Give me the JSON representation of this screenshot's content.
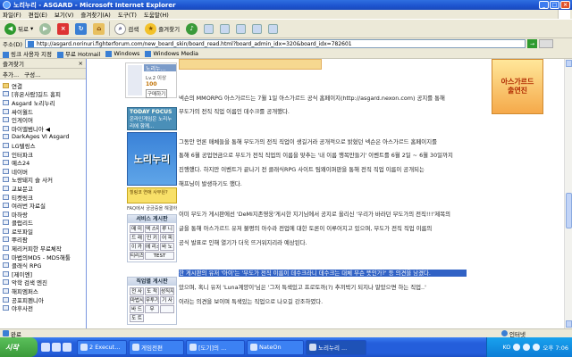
{
  "window": {
    "title": "노리누리 - ASGARD - Microsoft Internet Explorer",
    "min": "_",
    "max": "□",
    "close": "×"
  },
  "menu": [
    "파일(F)",
    "편집(E)",
    "보기(V)",
    "즐겨찾기(A)",
    "도구(T)",
    "도움말(H)"
  ],
  "toolbar": {
    "back": "뒤로",
    "search": "검색",
    "favorites": "즐겨찾기"
  },
  "address": {
    "label": "주소(D)",
    "url": "http://asgard.norinuri.fighterforum.com/new_board_skin/board_read.html?board_admin_idx=320&board_idx=782601",
    "go": "이동"
  },
  "links": {
    "label": "연결",
    "items": [
      "링크 사용자 지정",
      "무료 Hotmail",
      "Windows",
      "Windows Media"
    ]
  },
  "sidebar": {
    "title": "즐겨찾기",
    "add": "추가...",
    "organize": "구성...",
    "items": [
      "연결",
      "[휴온사람]길드 홈피",
      "Asgard 노리누리",
      "싸이월드",
      "인게이머",
      "마이앨범니아 ◀",
      "DarkAges VI  Asgard",
      "LG텔링스",
      "인터파크",
      "예스24",
      "네이버",
      "노랑돼지 슬 사커",
      "교보문고",
      "티켓링크",
      "여러번 자료실",
      "마하랑",
      "클럽리드",
      "로또파일",
      "뿌리팜",
      "제리커피한 무료체작",
      "마법의MD5 - MD5해툴",
      "클래식 RPG",
      "[제이엔]",
      "악학 검색 엔진",
      "해피엠퍼스",
      "공포피펜니아",
      "야후사전"
    ]
  },
  "left_nav": {
    "nickname": "노리누...",
    "level": "Lv.2 이상",
    "points": "100",
    "subscribe": "구매하기",
    "today_focus": "TODAY FOCUS",
    "today_desc": "온라인게임은 노리누리에 함께...",
    "banner": "노리누리",
    "yellow_banner": "힐링코 연애 사무원?",
    "faq": "FAQ에서 궁금증을 해결하세요.",
    "service_board": {
      "title": "서비스 게시판",
      "items": [
        "매 미",
        "엑 스티",
        "루 니",
        "드 래",
        "인 키",
        "어 피",
        "이 카",
        "에 리스",
        "바 노",
        "티리즈",
        "TEST"
      ]
    },
    "job_board": {
      "title": "직업별 게시판",
      "items": [
        "전 사",
        "도 적",
        "성직자",
        "마법사",
        "무투가",
        "기 사",
        "바 드",
        "무",
        "",
        "도 트",
        "토로",
        ""
      ]
    }
  },
  "article": {
    "lines": [
      "넥슨의 MMORPG 아스가르드는 7월 1일 아스가르드 공식 홈페이지(http://asgard.nexon.com) 공지를 통해",
      "무도가의 전직 직업 이름인 데수크를 공개했다.",
      "",
      "그동안 언론 매체들을 통해 무도가의 전직 직업이 생길거라 공개적으로 밝혔던 넥슨은 아스가르드 홈페이지를",
      "통해 6월 공업연금으로 무도가 전직 직업의 이름을 맞추는 '내 이름 행복만들기' 이벤트를 6월 2일 ~ 6월 30일까지",
      "진행했다. 하지만 이벤트가 끝나기 전 클래식RPG 사이트 팀왜이퍼판을 통해 전직 직업 이름이 공개되는",
      "해프닝이 발생하기도 했다.",
      "",
      "이미 무도가 게시판에선 'DeMi지존영웅'게시한 지기님에서 공지로 올리신 '우리가 바라던 무도가의 전직!!!'제목의",
      "글을 통해 아스가르드 유저 불평의 아수라 전업에 대한 토론이 이루어지고 있으며, 무도가 전직 직업 이름의",
      "공식 발표로 인해 열기가 더욱 뜨거워지리라 예상된다.",
      "",
      "한 게시판의 유저 '아이'는 '무도가 전직 이름이 데수크라니 데수크는 대체 무슨 뜻인가?' 등 의견을 남겼다.",
      "았으며, 혹니 유저 'Luna계양이'님은 '그저 특색있고 프로토까(?) 추끼박기 되지나 말았으면 하는 직업..'",
      "이라는 의견을 보이며 특색있는 직업으로 나오길 강조하였다."
    ],
    "highlight_index": 12
  },
  "right_ad": {
    "line1": "아스가르드",
    "line2": "출연진"
  },
  "status": {
    "text": "완료",
    "zone": "인터넷"
  },
  "taskbar": {
    "start": "시작",
    "tasks": [
      "2 Execut...",
      "게임전편",
      "[도기]의 ...",
      "NateOn",
      "노리누리 ..."
    ],
    "active_index": 4,
    "clock": "오후 7:06",
    "ime": "KO"
  }
}
